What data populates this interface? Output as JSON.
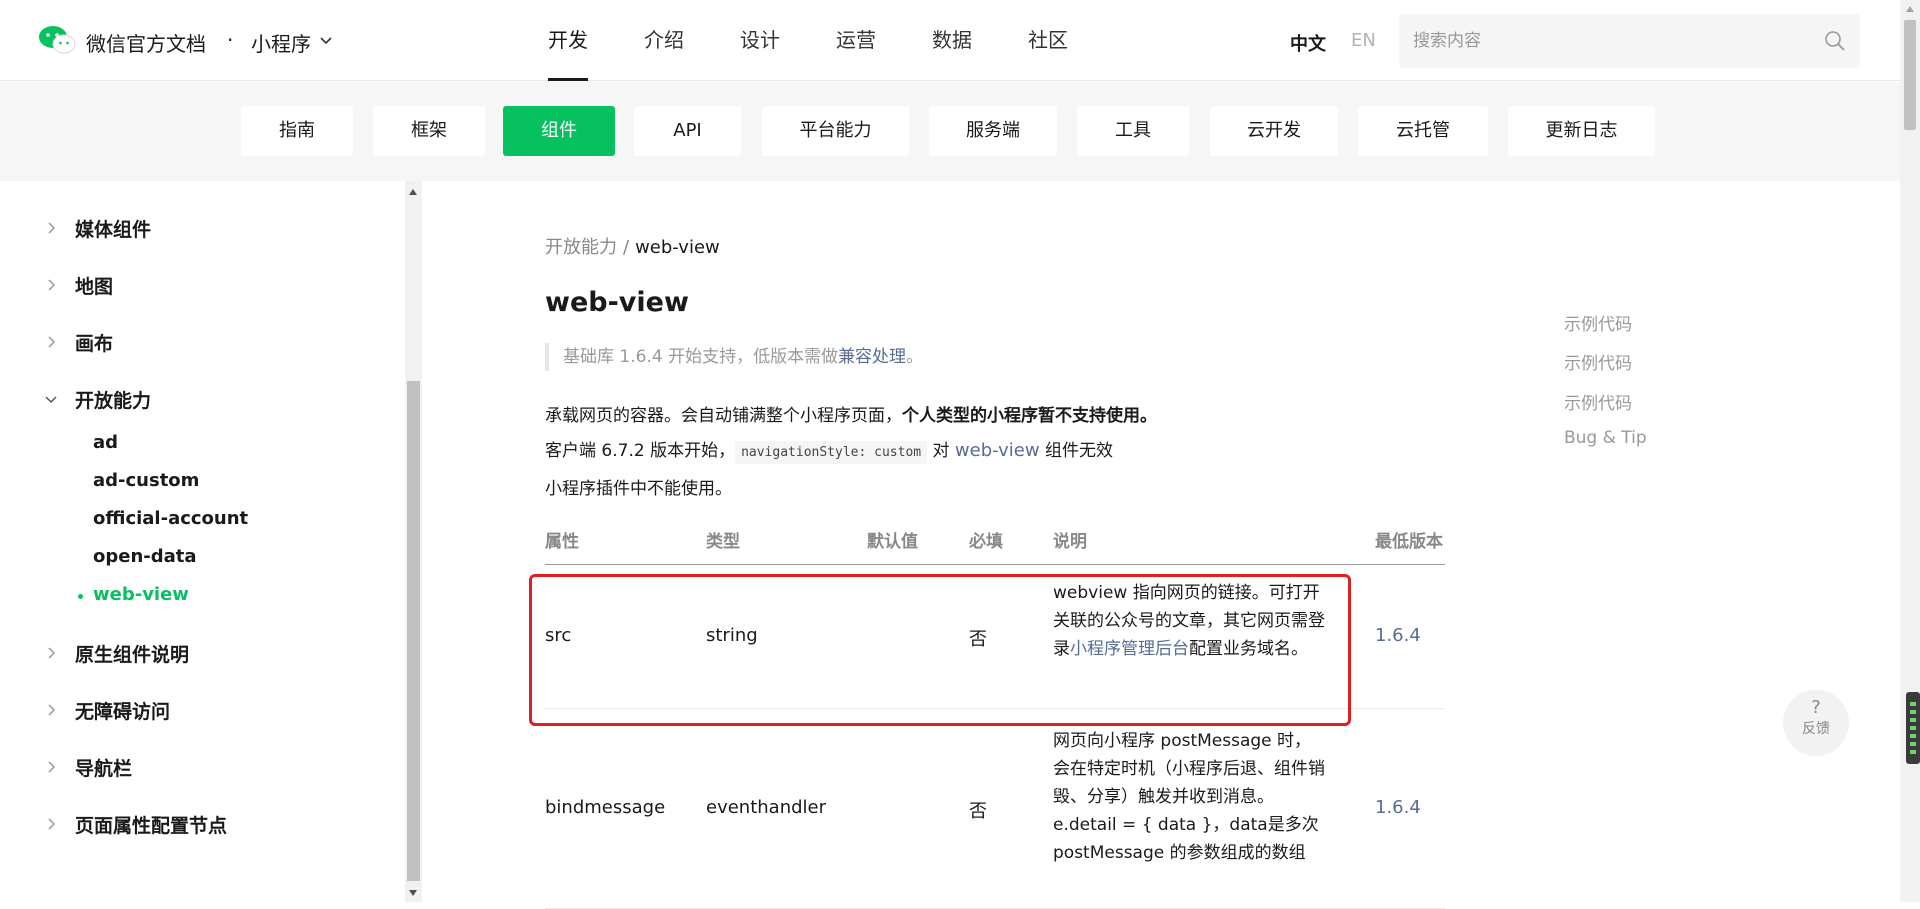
{
  "header": {
    "brand": "微信官方文档",
    "dot": "·",
    "product": "小程序",
    "nav": [
      "开发",
      "介绍",
      "设计",
      "运营",
      "数据",
      "社区"
    ],
    "active_nav": "开发",
    "lang_zh": "中文",
    "lang_en": "EN",
    "search_placeholder": "搜索内容"
  },
  "categories": [
    "指南",
    "框架",
    "组件",
    "API",
    "平台能力",
    "服务端",
    "工具",
    "云开发",
    "云托管",
    "更新日志"
  ],
  "active_category": "组件",
  "sidebar": {
    "items": [
      {
        "label": "媒体组件",
        "expanded": false
      },
      {
        "label": "地图",
        "expanded": false
      },
      {
        "label": "画布",
        "expanded": false
      },
      {
        "label": "开放能力",
        "expanded": true
      },
      {
        "label": "原生组件说明",
        "expanded": false
      },
      {
        "label": "无障碍访问",
        "expanded": false
      },
      {
        "label": "导航栏",
        "expanded": false
      },
      {
        "label": "页面属性配置节点",
        "expanded": false
      }
    ],
    "subitems": [
      "ad",
      "ad-custom",
      "official-account",
      "open-data",
      "web-view"
    ],
    "active_sub": "web-view"
  },
  "page": {
    "breadcrumb_parent": "开放能力",
    "breadcrumb_sep": "/",
    "breadcrumb_current": "web-view",
    "title": "web-view",
    "note_prefix": "基础库 1.6.4 开始支持，低版本需做",
    "note_link": "兼容处理",
    "note_suffix": "。",
    "p1_text": "承载网页的容器。会自动铺满整个小程序页面，",
    "p1_bold": "个人类型的小程序暂不支持使用。",
    "p2_prefix": "客户端 6.7.2 版本开始，",
    "p2_code": "navigationStyle: custom",
    "p2_mid": " 对 ",
    "p2_link": "web-view",
    "p2_suffix": " 组件无效",
    "p3": "小程序插件中不能使用。"
  },
  "table": {
    "headers": [
      "属性",
      "类型",
      "默认值",
      "必填",
      "说明",
      "最低版本"
    ],
    "rows": [
      {
        "attr": "src",
        "type": "string",
        "default": "",
        "required": "否",
        "desc_prefix": "webview 指向网页的链接。可打开关联的公众号的文章，其它网页需登录",
        "desc_link": "小程序管理后台",
        "desc_suffix": "配置业务域名。",
        "version": "1.6.4"
      },
      {
        "attr": "bindmessage",
        "type": "eventhandler",
        "default": "",
        "required": "否",
        "desc_prefix": "网页向小程序 postMessage 时，会在特定时机（小程序后退、组件销毁、分享）触发并收到消息。e.detail = { data }，data是多次 postMessage 的参数组成的数组",
        "desc_link": "",
        "desc_suffix": "",
        "version": "1.6.4"
      }
    ]
  },
  "toc": [
    "示例代码",
    "示例代码",
    "示例代码",
    "Bug & Tip"
  ],
  "feedback": {
    "icon": "?",
    "label": "反馈"
  },
  "colors": {
    "accent": "#07c160",
    "link": "#576b95",
    "highlight": "#e02020"
  }
}
